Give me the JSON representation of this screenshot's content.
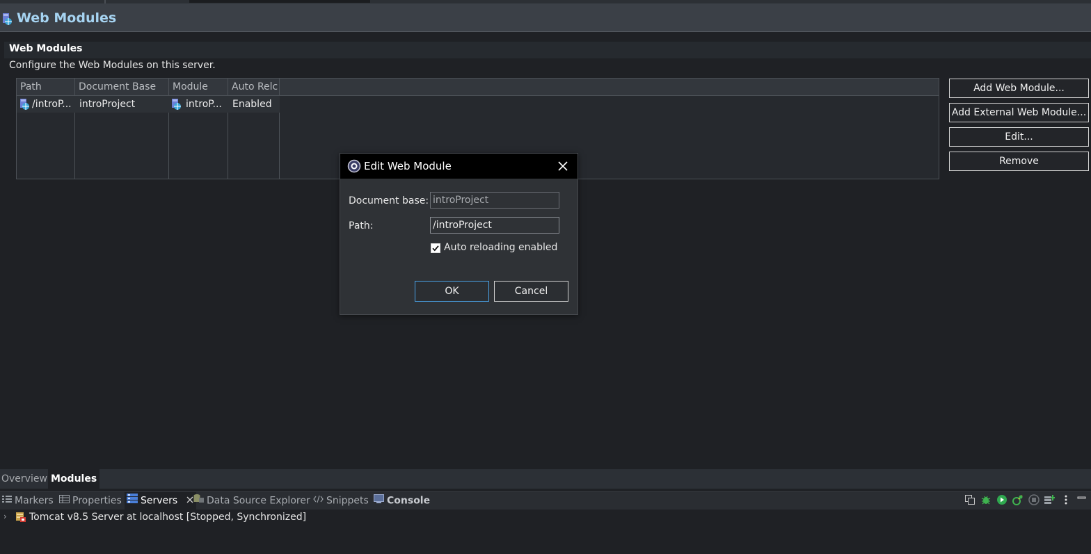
{
  "header": {
    "title": "Web Modules",
    "icon": "web-module-icon"
  },
  "section": {
    "title": "Web Modules",
    "description": "Configure the Web Modules on this server."
  },
  "table": {
    "columns": [
      "Path",
      "Document Base",
      "Module",
      "Auto Relc"
    ],
    "rows": [
      {
        "path": "/introP...",
        "document_base": "introProject",
        "module": "introP...",
        "auto_reload": "Enabled"
      }
    ]
  },
  "side_buttons": {
    "add": "Add Web Module...",
    "add_external": "Add External Web Module...",
    "edit": "Edit...",
    "remove": "Remove"
  },
  "dialog": {
    "title": "Edit Web Module",
    "document_base_label": "Document base:",
    "document_base_value": "introProject",
    "path_label": "Path:",
    "path_value": "/introProject",
    "auto_reload_label": "Auto reloading enabled",
    "auto_reload_checked": true,
    "ok": "OK",
    "cancel": "Cancel"
  },
  "editor_tabs": {
    "overview": "Overview",
    "modules": "Modules"
  },
  "view_tabs": {
    "markers": "Markers",
    "properties": "Properties",
    "servers": "Servers",
    "data_source_explorer": "Data Source Explorer",
    "snippets": "Snippets",
    "console": "Console"
  },
  "servers": {
    "name": "Tomcat v8.5 Server at localhost",
    "status": "[Stopped, Synchronized]"
  },
  "colors": {
    "accent": "#4aa1e6",
    "header_title": "#a6d4f2",
    "background": "#1f2125"
  }
}
